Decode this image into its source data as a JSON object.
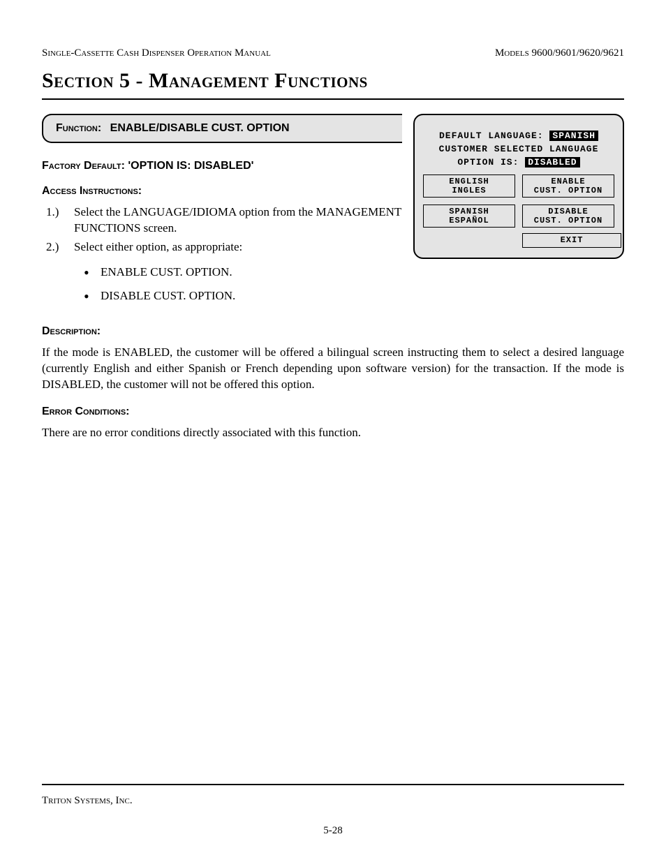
{
  "header": {
    "left": "Single-Cassette Cash Dispenser Operation Manual",
    "right": "Models 9600/9601/9620/9621"
  },
  "section_title": "Section 5 - Management Functions",
  "function_tab": {
    "label": "Function:",
    "name": "ENABLE/DISABLE CUST. OPTION"
  },
  "factory_default": {
    "label": "Factory Default:",
    "value": "'OPTION IS: DISABLED'"
  },
  "access": {
    "heading": "Access Instructions:",
    "steps": [
      "Select the LANGUAGE/IDIOMA option from the MANAGEMENT FUNCTIONS screen.",
      "Select either option, as appropriate:"
    ],
    "options": [
      "ENABLE CUST. OPTION.",
      "DISABLE CUST. OPTION."
    ]
  },
  "description": {
    "heading": "Description:",
    "text": "If the mode is ENABLED, the customer will be offered a bilingual screen instructing them to select a desired language (currently English and either Spanish or French depending upon software version) for the transaction. If the mode is DISABLED, the customer will not be offered this option."
  },
  "error": {
    "heading": "Error Conditions:",
    "text": "There are no error conditions directly associated with this function."
  },
  "atm_screen": {
    "line1_label": "DEFAULT LANGUAGE:",
    "line1_value": "SPANISH",
    "line2": "CUSTOMER SELECTED LANGUAGE",
    "line3_label": "OPTION IS:",
    "line3_value": "DISABLED",
    "buttons": {
      "english_l1": "ENGLISH",
      "english_l2": "INGLES",
      "spanish_l1": "SPANISH",
      "spanish_l2": "ESPAÑOL",
      "enable_l1": "ENABLE",
      "enable_l2": "CUST. OPTION",
      "disable_l1": "DISABLE",
      "disable_l2": "CUST. OPTION",
      "exit": "EXIT"
    }
  },
  "footer": {
    "company": "Triton Systems, Inc.",
    "page": "5-28"
  }
}
